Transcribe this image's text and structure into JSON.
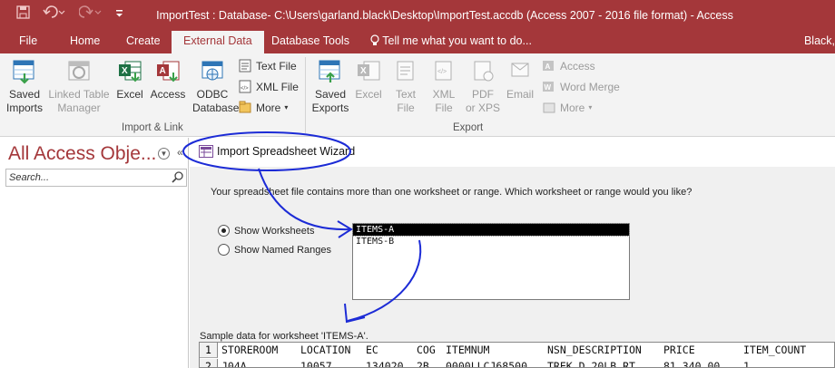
{
  "window": {
    "title": "ImportTest : Database- C:\\Users\\garland.black\\Desktop\\ImportTest.accdb (Access 2007 - 2016 file format) - Access"
  },
  "tabs": [
    {
      "label": "File"
    },
    {
      "label": "Home"
    },
    {
      "label": "Create"
    },
    {
      "label": "External Data"
    },
    {
      "label": "Database Tools"
    }
  ],
  "tell_me": "Tell me what you want to do...",
  "user": "Black,",
  "ribbon": {
    "import_link": {
      "group_label": "Import & Link",
      "saved_imports": [
        "Saved",
        "Imports"
      ],
      "linked_table_manager": [
        "Linked Table",
        "Manager"
      ],
      "excel": "Excel",
      "access": "Access",
      "odbc": [
        "ODBC",
        "Database"
      ],
      "text_file": "Text File",
      "xml_file": "XML File",
      "more": "More"
    },
    "export": {
      "group_label": "Export",
      "saved_exports": [
        "Saved",
        "Exports"
      ],
      "excel": "Excel",
      "text_file": [
        "Text",
        "File"
      ],
      "xml_file": [
        "XML",
        "File"
      ],
      "pdf_xps": [
        "PDF",
        "or XPS"
      ],
      "email": "Email",
      "access": "Access",
      "word_merge": "Word Merge",
      "more": "More"
    }
  },
  "nav": {
    "title": "All Access Obje...",
    "search_placeholder": "Search..."
  },
  "wizard": {
    "title": "Import Spreadsheet Wizard",
    "prompt": "Your spreadsheet file contains more than one worksheet or range. Which worksheet or range would you like?",
    "show_worksheets": "Show Worksheets",
    "show_named_ranges": "Show Named Ranges",
    "worksheets": [
      "ITEMS-A",
      "ITEMS-B"
    ],
    "selected_index": 0,
    "sample_label": "Sample data for worksheet 'ITEMS-A'.",
    "sample_rows": [
      {
        "num": "1",
        "cells": [
          "STOREROOM",
          "LOCATION",
          "EC",
          "COG",
          "ITEMNUM",
          "NSN_DESCRIPTION",
          "PRICE",
          "ITEM_COUNT"
        ]
      },
      {
        "num": "2",
        "cells": [
          "J04A",
          "10057",
          "134020",
          "2B",
          "0000LLCJ68500",
          "TREK D 20LB RT",
          "81,340.00",
          "1"
        ]
      }
    ]
  },
  "colors": {
    "accent": "#a4373a",
    "annotation": "#1c2bd6"
  }
}
